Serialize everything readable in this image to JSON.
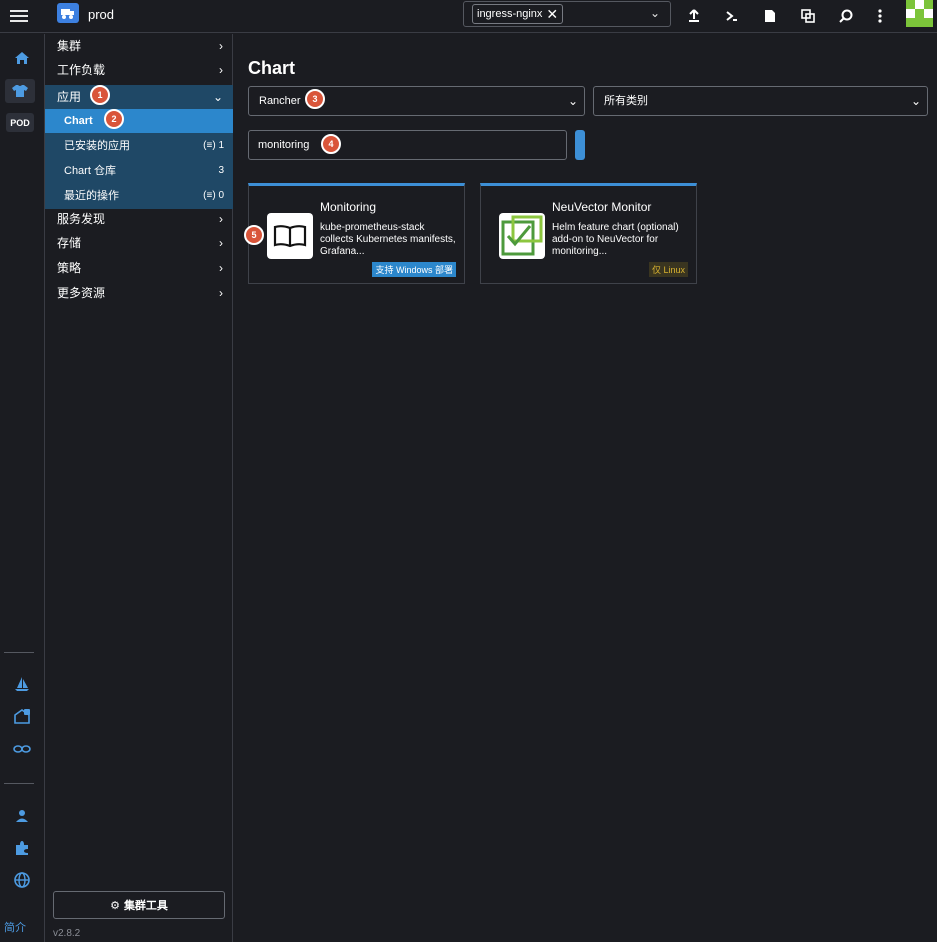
{
  "topbar": {
    "cluster_name": "prod",
    "namespace_chip": "ingress-nginx"
  },
  "leftbar": {
    "pod_label": "POD",
    "bottom_label": "简介"
  },
  "sidenav": {
    "groups_top": [
      {
        "label": "集群"
      },
      {
        "label": "工作负载"
      }
    ],
    "apps": {
      "label": "应用",
      "items": [
        {
          "label": "Chart",
          "count": ""
        },
        {
          "label": "已安装的应用",
          "count": "1"
        },
        {
          "label": "Chart 仓库",
          "count": "3"
        },
        {
          "label": "最近的操作",
          "count": "0"
        }
      ]
    },
    "groups_bottom": [
      {
        "label": "服务发现"
      },
      {
        "label": "存储"
      },
      {
        "label": "策略"
      },
      {
        "label": "更多资源"
      }
    ],
    "cluster_tools": "集群工具",
    "version": "v2.8.2"
  },
  "main": {
    "title": "Chart",
    "repo_select": "Rancher",
    "category_select": "所有类别",
    "search_value": "monitoring",
    "cards": [
      {
        "title": "Monitoring",
        "description": "kube-prometheus-stack collects Kubernetes manifests, Grafana...",
        "tag": "支持 Windows 部署"
      },
      {
        "title": "NeuVector Monitor",
        "description": "Helm feature chart (optional) add-on to NeuVector for monitoring...",
        "tag": "仅 Linux"
      }
    ]
  },
  "markers": [
    "1",
    "2",
    "3",
    "4",
    "5"
  ],
  "colors": {
    "accent": "#3d8fd6",
    "nav_active": "#2c87cc",
    "nav_section": "#1f4866",
    "marker": "#d9553a",
    "windows_tag": "#2c87cc",
    "linux_tag": "#d8b230"
  }
}
